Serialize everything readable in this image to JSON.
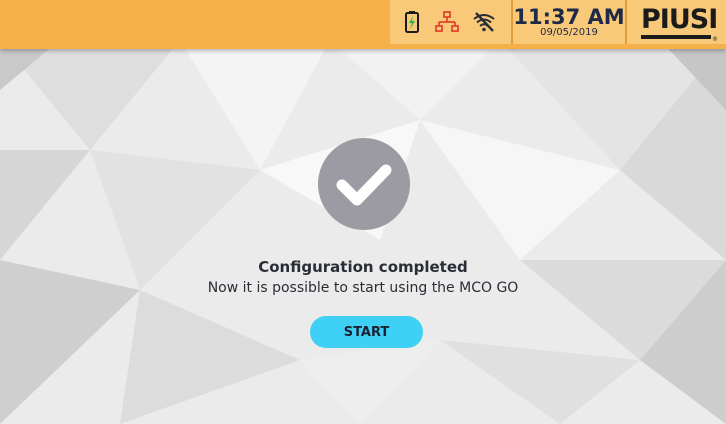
{
  "status_bar": {
    "icons": [
      "battery-icon",
      "network-icon",
      "wifi-off-icon"
    ],
    "time": "11:37 AM",
    "date": "09/05/2019",
    "brand": "PIUSI",
    "colors": {
      "bar": "#f6b04a",
      "panel": "#f8c978",
      "network_icon": "#e2462b"
    }
  },
  "main": {
    "status_icon": "checkmark-icon",
    "title": "Configuration completed",
    "message": "Now it is possible to start using the MCO GO",
    "start_label": "START",
    "colors": {
      "check_circle": "#9c9aa3",
      "button": "#3fd0f5"
    }
  }
}
